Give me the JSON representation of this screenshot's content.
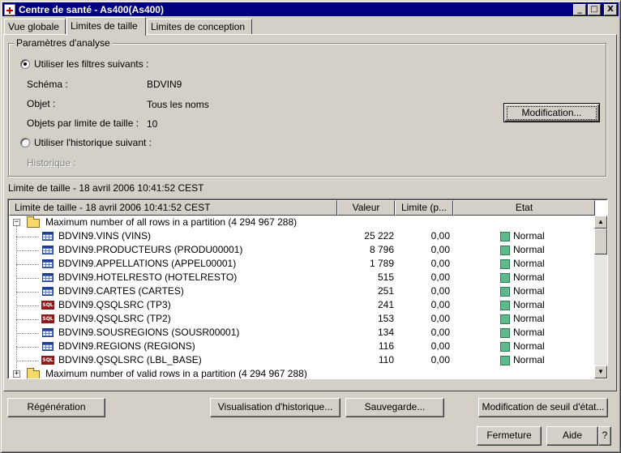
{
  "window": {
    "title": "Centre de santé - As400(As400)",
    "minimize": "_",
    "maximize": "□",
    "close": "X"
  },
  "tabs": [
    {
      "label": "Vue globale",
      "active": false
    },
    {
      "label": "Limites de taille",
      "active": true
    },
    {
      "label": "Limites de conception",
      "active": false
    }
  ],
  "analysis": {
    "group_title": "Paramètres d'analyse",
    "use_filters_label": "Utiliser les filtres suivants :",
    "schema_label": "Schéma :",
    "schema_value": "BDVIN9",
    "object_label": "Objet :",
    "object_value": "Tous les noms",
    "objects_per_limit_label": "Objets par limite de taille :",
    "objects_per_limit_value": "10",
    "use_history_label": "Utiliser l'historique suivant :",
    "history_label": "Historique :",
    "modify_button": "Modification..."
  },
  "section_label": "Limite de taille - 18 avril 2006 10:41:52 CEST",
  "table": {
    "headers": [
      "Limite de taille - 18 avril 2006 10:41:52 CEST",
      "Valeur",
      "Limite (p...",
      "Etat"
    ],
    "group1": "Maximum number of all rows in a partition  (4 294 967 288)",
    "group2": "Maximum number of valid rows in a partition  (4 294 967 288)",
    "rows": [
      {
        "name": "BDVIN9.VINS  (VINS)",
        "value": "25 222",
        "limit": "0,00",
        "status": "Normal",
        "icon": "table"
      },
      {
        "name": "BDVIN9.PRODUCTEURS  (PRODU00001)",
        "value": "8 796",
        "limit": "0,00",
        "status": "Normal",
        "icon": "table"
      },
      {
        "name": "BDVIN9.APPELLATIONS  (APPEL00001)",
        "value": "1 789",
        "limit": "0,00",
        "status": "Normal",
        "icon": "table"
      },
      {
        "name": "BDVIN9.HOTELRESTO  (HOTELRESTO)",
        "value": "515",
        "limit": "0,00",
        "status": "Normal",
        "icon": "table"
      },
      {
        "name": "BDVIN9.CARTES  (CARTES)",
        "value": "251",
        "limit": "0,00",
        "status": "Normal",
        "icon": "table"
      },
      {
        "name": "BDVIN9.QSQLSRC  (TP3)",
        "value": "241",
        "limit": "0,00",
        "status": "Normal",
        "icon": "sql"
      },
      {
        "name": "BDVIN9.QSQLSRC  (TP2)",
        "value": "153",
        "limit": "0,00",
        "status": "Normal",
        "icon": "sql"
      },
      {
        "name": "BDVIN9.SOUSREGIONS  (SOUSR00001)",
        "value": "134",
        "limit": "0,00",
        "status": "Normal",
        "icon": "table"
      },
      {
        "name": "BDVIN9.REGIONS  (REGIONS)",
        "value": "116",
        "limit": "0,00",
        "status": "Normal",
        "icon": "table"
      },
      {
        "name": "BDVIN9.QSQLSRC  (LBL_BASE)",
        "value": "110",
        "limit": "0,00",
        "status": "Normal",
        "icon": "sql"
      }
    ],
    "sql_icon_text": "SQL",
    "status_color": "#5fb98a"
  },
  "buttons": {
    "regenerate": "Régénération",
    "history": "Visualisation d'historique...",
    "save": "Sauvegarde...",
    "threshold": "Modification de seuil d'état...",
    "close": "Fermeture",
    "help": "Aide",
    "question": "?"
  },
  "colors": {
    "titlebar": "#000080",
    "face": "#d4d0c8"
  }
}
